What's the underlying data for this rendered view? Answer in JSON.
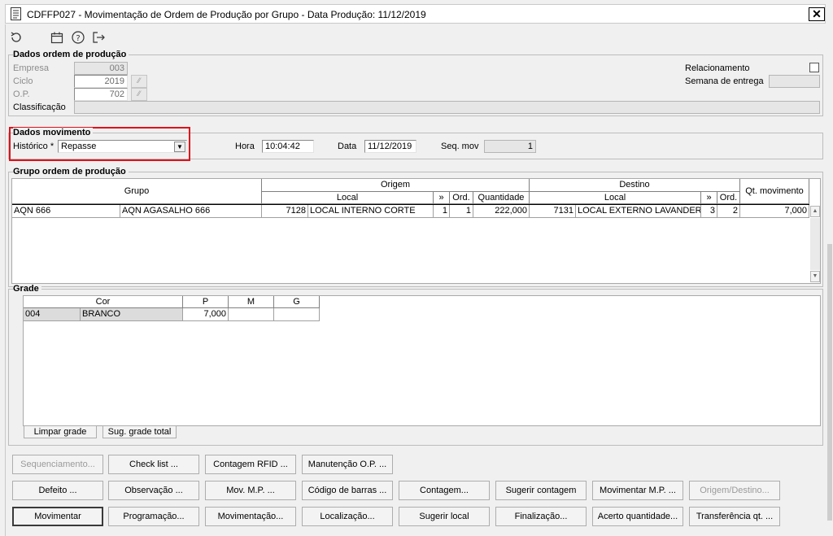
{
  "window": {
    "title": "CDFFP027 - Movimentação de Ordem de Produção por Grupo - Data Produção: 11/12/2019",
    "close_label": "✕"
  },
  "toolbar": {
    "icons": [
      "refresh-icon",
      "calendar-icon",
      "help-icon",
      "exit-icon"
    ]
  },
  "dados_ordem": {
    "title": "Dados ordem de produção",
    "empresa_label": "Empresa",
    "empresa_value": "003",
    "ciclo_label": "Ciclo",
    "ciclo_value": "2019",
    "op_label": "O.P.",
    "op_value": "702",
    "classificacao_label": "Classificação",
    "classificacao_value": "",
    "relacionamento_label": "Relacionamento",
    "semana_label": "Semana de entrega",
    "semana_value": "",
    "lookup_glyph": "⁄⁄"
  },
  "dados_movimento": {
    "title": "Dados movimento",
    "historico_label": "Histórico *",
    "historico_value": "Repasse",
    "hora_label": "Hora",
    "hora_value": "10:04:42",
    "data_label": "Data",
    "data_value": "11/12/2019",
    "seq_label": "Seq. mov",
    "seq_value": "1",
    "combo_glyph": "▼"
  },
  "grupo_ordem": {
    "title": "Grupo ordem de produção",
    "headers": {
      "grupo": "Grupo",
      "origem": "Origem",
      "destino": "Destino",
      "local": "Local",
      "expand": "»",
      "ord": "Ord.",
      "quantidade": "Quantidade",
      "qt_movimento": "Qt. movimento"
    },
    "row": {
      "grupo_code": "AQN 666",
      "grupo_desc": "AQN AGASALHO 666",
      "origem_code": "7128",
      "origem_local": "LOCAL INTERNO CORTE",
      "origem_x": "1",
      "origem_ord": "1",
      "quantidade": "222,000",
      "destino_code": "7131",
      "destino_local": "LOCAL EXTERNO LAVANDERIA",
      "destino_x": "3",
      "destino_ord": "2",
      "qt_movimento": "7,000"
    },
    "scroll_up": "▲",
    "scroll_down": "▼"
  },
  "grade": {
    "title": "Grade",
    "headers": [
      "Cor",
      "P",
      "M",
      "G"
    ],
    "row": {
      "cor_code": "004",
      "cor_desc": "BRANCO",
      "p": "7,000",
      "m": "",
      "g": ""
    },
    "limpar_label": "Limpar grade",
    "sugerir_label": "Sug. grade total"
  },
  "buttons": {
    "row1": [
      "Sequenciamento...",
      "Check list ...",
      "Contagem RFID ...",
      "Manutenção O.P. ..."
    ],
    "row2": [
      "Defeito ...",
      "Observação ...",
      "Mov. M.P. ...",
      "Código de barras ...",
      "Contagem...",
      "Sugerir contagem",
      "Movimentar M.P. ...",
      "Origem/Destino..."
    ],
    "row3": [
      "Movimentar",
      "Programação...",
      "Movimentação...",
      "Localização...",
      "Sugerir local",
      "Finalização...",
      "Acerto quantidade...",
      "Transferência qt. ..."
    ]
  }
}
